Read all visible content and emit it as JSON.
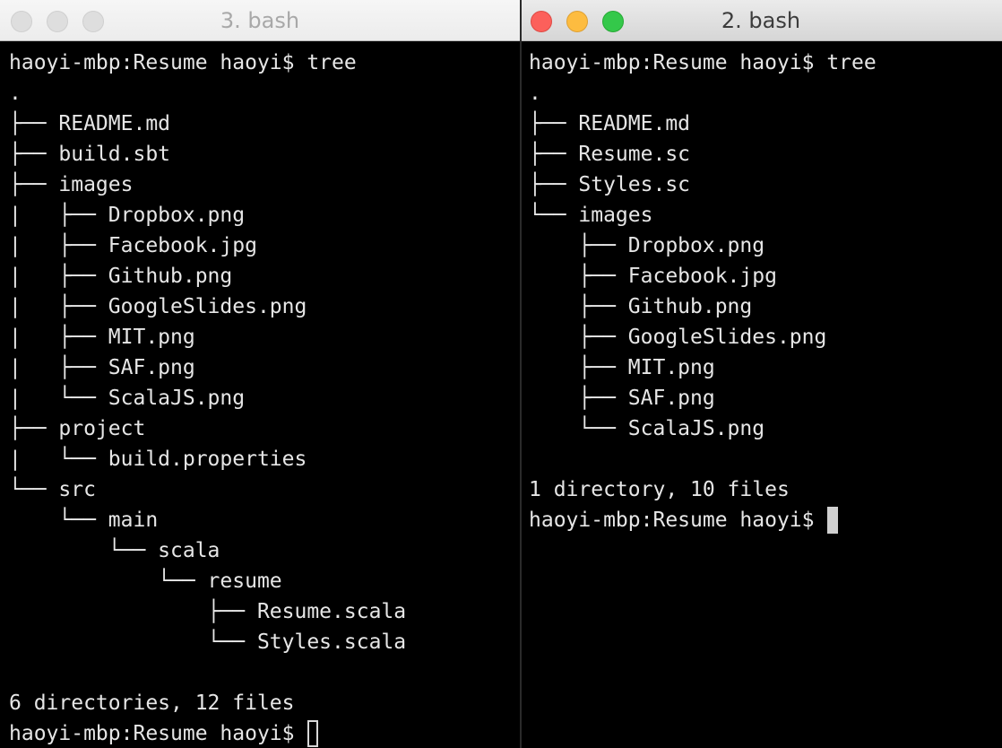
{
  "left_window": {
    "title": "3. bash",
    "lines": [
      "haoyi-mbp:Resume haoyi$ tree",
      ".",
      "├── README.md",
      "├── build.sbt",
      "├── images",
      "|   ├── Dropbox.png",
      "|   ├── Facebook.jpg",
      "|   ├── Github.png",
      "|   ├── GoogleSlides.png",
      "|   ├── MIT.png",
      "|   ├── SAF.png",
      "|   └── ScalaJS.png",
      "├── project",
      "|   └── build.properties",
      "└── src",
      "    └── main",
      "        └── scala",
      "            └── resume",
      "                ├── Resume.scala",
      "                └── Styles.scala",
      "",
      "6 directories, 12 files"
    ],
    "prompt": "haoyi-mbp:Resume haoyi$"
  },
  "right_window": {
    "title": "2. bash",
    "lines": [
      "haoyi-mbp:Resume haoyi$ tree",
      ".",
      "├── README.md",
      "├── Resume.sc",
      "├── Styles.sc",
      "└── images",
      "    ├── Dropbox.png",
      "    ├── Facebook.jpg",
      "    ├── Github.png",
      "    ├── GoogleSlides.png",
      "    ├── MIT.png",
      "    ├── SAF.png",
      "    └── ScalaJS.png",
      "",
      "1 directory, 10 files"
    ],
    "prompt": "haoyi-mbp:Resume haoyi$"
  },
  "colors": {
    "terminal_bg": "#000000",
    "terminal_fg": "#e6e6e6",
    "close": "#fc605b",
    "minimize": "#fdbc40",
    "zoom": "#34c84a"
  }
}
